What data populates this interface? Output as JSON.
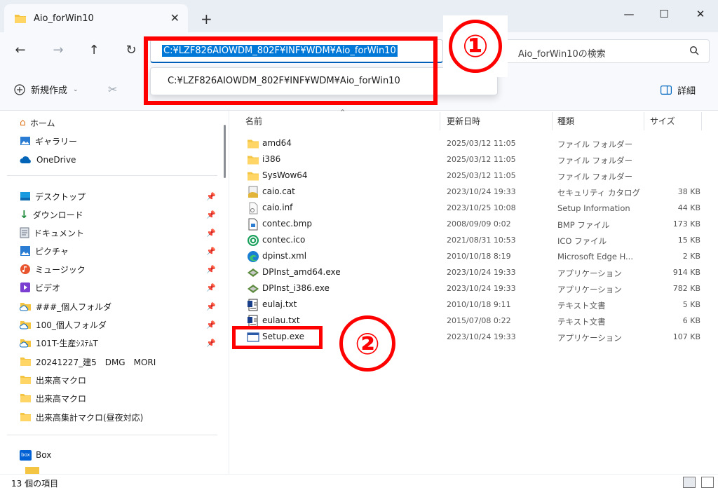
{
  "window": {
    "tab_title": "Aio_forWin10",
    "close_tab": "✕",
    "new_tab": "+",
    "minimize": "—",
    "maximize": "☐",
    "close": "✕"
  },
  "nav": {
    "address": "C:¥LZF826AIOWDM_802F¥INF¥WDM¥Aio_forWin10",
    "dropdown_suggestion": "C:¥LZF826AIOWDM_802F¥INF¥WDM¥Aio_forWin10",
    "search_placeholder": "Aio_forWin10の検索"
  },
  "commandbar": {
    "new_label": "新規作成",
    "details_label": "詳細"
  },
  "annotations": {
    "marker1": "①",
    "marker2": "②"
  },
  "sidebar": {
    "top": [
      {
        "label": "ホーム",
        "icon": "home-icon"
      },
      {
        "label": "ギャラリー",
        "icon": "gallery-icon"
      },
      {
        "label": "OneDrive",
        "icon": "cloud-icon"
      }
    ],
    "quick": [
      {
        "label": "デスクトップ",
        "icon": "desktop-icon",
        "pinned": true
      },
      {
        "label": "ダウンロード",
        "icon": "download-icon",
        "pinned": true
      },
      {
        "label": "ドキュメント",
        "icon": "document-icon",
        "pinned": true
      },
      {
        "label": "ピクチャ",
        "icon": "picture-icon",
        "pinned": true
      },
      {
        "label": "ミュージック",
        "icon": "music-icon",
        "pinned": true
      },
      {
        "label": "ビデオ",
        "icon": "video-icon",
        "pinned": true
      },
      {
        "label": "###_個人フォルダ",
        "icon": "cloud-folder-icon",
        "pinned": true
      },
      {
        "label": "100_個人フォルダ",
        "icon": "cloud-folder-icon",
        "pinned": true
      },
      {
        "label": "101T-生産ｼｽﾃﾑT",
        "icon": "cloud-folder-icon",
        "pinned": true
      },
      {
        "label": "20241227_建5　DMG　MORI",
        "icon": "folder-icon",
        "pinned": false
      },
      {
        "label": "出来高マクロ",
        "icon": "folder-icon",
        "pinned": false
      },
      {
        "label": "出来高マクロ",
        "icon": "folder-icon",
        "pinned": false
      },
      {
        "label": "出来高集計マクロ(昼夜対応)",
        "icon": "folder-icon",
        "pinned": false
      }
    ],
    "box": {
      "label": "Box",
      "icon_text": "box"
    }
  },
  "columns": {
    "name": "名前",
    "date": "更新日時",
    "type": "種類",
    "size": "サイズ"
  },
  "files": [
    {
      "name": "amd64",
      "date": "2025/03/12 11:05",
      "type": "ファイル フォルダー",
      "size": "",
      "icon": "folder"
    },
    {
      "name": "i386",
      "date": "2025/03/12 11:05",
      "type": "ファイル フォルダー",
      "size": "",
      "icon": "folder"
    },
    {
      "name": "SysWow64",
      "date": "2025/03/12 11:05",
      "type": "ファイル フォルダー",
      "size": "",
      "icon": "folder"
    },
    {
      "name": "caio.cat",
      "date": "2023/10/24 19:33",
      "type": "セキュリティ カタログ",
      "size": "38 KB",
      "icon": "catalog"
    },
    {
      "name": "caio.inf",
      "date": "2023/10/25 10:08",
      "type": "Setup Information",
      "size": "44 KB",
      "icon": "inf"
    },
    {
      "name": "contec.bmp",
      "date": "2008/09/09 0:02",
      "type": "BMP ファイル",
      "size": "173 KB",
      "icon": "bmp"
    },
    {
      "name": "contec.ico",
      "date": "2021/08/31 10:53",
      "type": "ICO ファイル",
      "size": "15 KB",
      "icon": "ico"
    },
    {
      "name": "dpinst.xml",
      "date": "2010/10/18 8:19",
      "type": "Microsoft Edge H...",
      "size": "2 KB",
      "icon": "edge"
    },
    {
      "name": "DPInst_amd64.exe",
      "date": "2023/10/24 19:33",
      "type": "アプリケーション",
      "size": "914 KB",
      "icon": "dpinst"
    },
    {
      "name": "DPInst_i386.exe",
      "date": "2023/10/24 19:33",
      "type": "アプリケーション",
      "size": "782 KB",
      "icon": "dpinst"
    },
    {
      "name": "eulaj.txt",
      "date": "2010/10/18 9:11",
      "type": "テキスト文書",
      "size": "5 KB",
      "icon": "txt"
    },
    {
      "name": "eulau.txt",
      "date": "2015/07/08 0:22",
      "type": "テキスト文書",
      "size": "6 KB",
      "icon": "txt"
    },
    {
      "name": "Setup.exe",
      "date": "2023/10/24 19:33",
      "type": "アプリケーション",
      "size": "107 KB",
      "icon": "setup"
    }
  ],
  "status": {
    "item_count": "13 個の項目"
  },
  "colors": {
    "accent": "#005fb8",
    "annotation": "#ff0000",
    "folder": "#f4c542"
  }
}
